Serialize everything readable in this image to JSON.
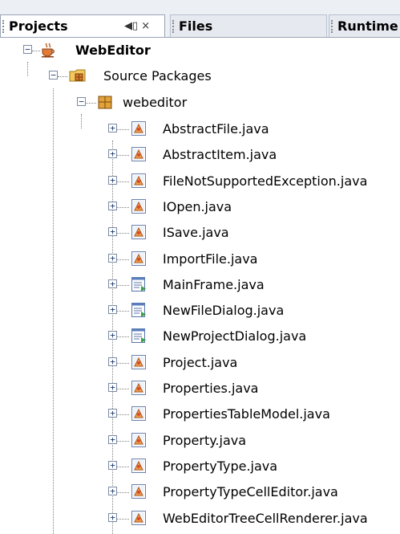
{
  "tabs": [
    {
      "label": "Projects",
      "active": true,
      "controls": "◀▯ ×"
    },
    {
      "label": "Files",
      "active": false
    },
    {
      "label": "Runtime",
      "active": false
    }
  ],
  "tree": {
    "project": {
      "label": "WebEditor",
      "icon": "coffee-cup-project-icon",
      "expanded": true
    },
    "source_packages": {
      "label": "Source Packages",
      "icon": "source-packages-icon",
      "expanded": true
    },
    "package": {
      "label": "webeditor",
      "icon": "package-icon",
      "expanded": true
    },
    "files": [
      {
        "label": "AbstractFile.java",
        "icon": "java-class-icon"
      },
      {
        "label": "AbstractItem.java",
        "icon": "java-class-icon"
      },
      {
        "label": "FileNotSupportedException.java",
        "icon": "java-class-icon"
      },
      {
        "label": "IOpen.java",
        "icon": "java-class-icon"
      },
      {
        "label": "ISave.java",
        "icon": "java-class-icon"
      },
      {
        "label": "ImportFile.java",
        "icon": "java-class-icon"
      },
      {
        "label": "MainFrame.java",
        "icon": "form-icon"
      },
      {
        "label": "NewFileDialog.java",
        "icon": "form-icon"
      },
      {
        "label": "NewProjectDialog.java",
        "icon": "form-icon"
      },
      {
        "label": "Project.java",
        "icon": "java-class-icon"
      },
      {
        "label": "Properties.java",
        "icon": "java-class-icon"
      },
      {
        "label": "PropertiesTableModel.java",
        "icon": "java-class-icon"
      },
      {
        "label": "Property.java",
        "icon": "java-class-icon"
      },
      {
        "label": "PropertyType.java",
        "icon": "java-class-icon"
      },
      {
        "label": "PropertyTypeCellEditor.java",
        "icon": "java-class-icon"
      },
      {
        "label": "WebEditorTreeCellRenderer.java",
        "icon": "java-class-icon"
      }
    ]
  }
}
